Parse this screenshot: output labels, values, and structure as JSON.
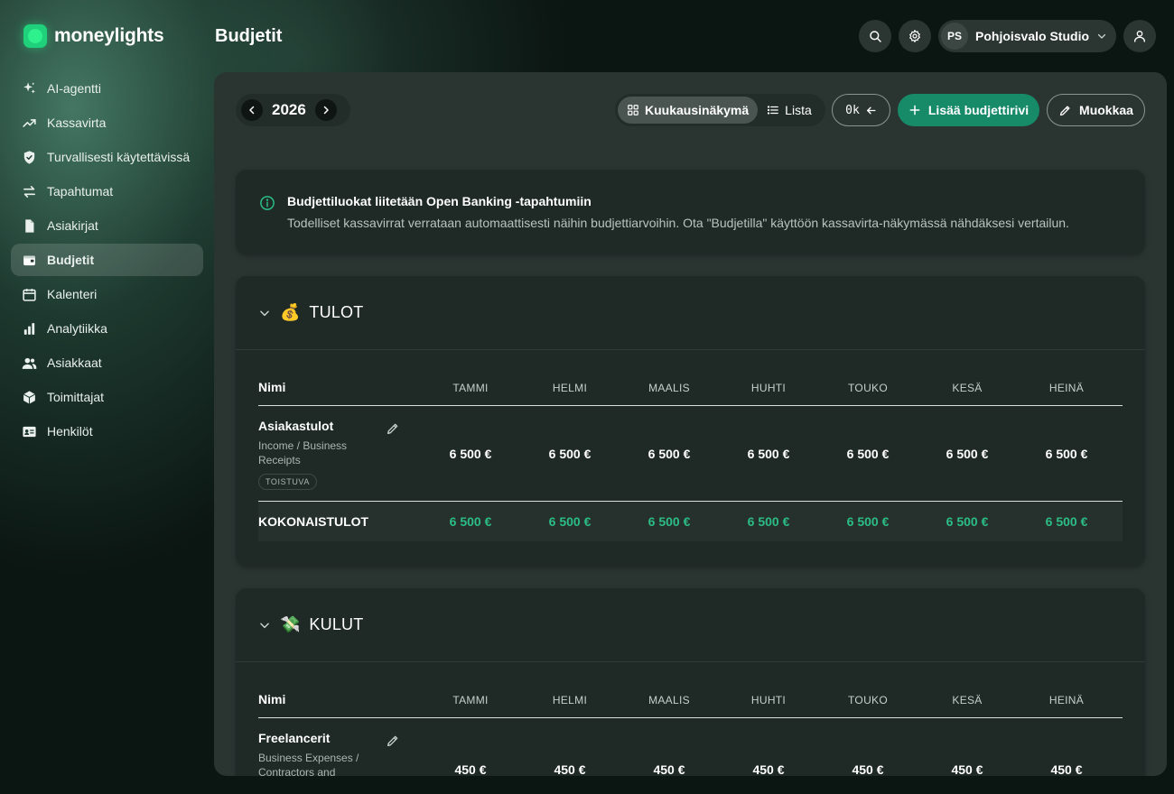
{
  "app": {
    "name": "moneylights"
  },
  "sidebar": {
    "items": [
      {
        "label": "AI-agentti",
        "icon": "sparkles-icon"
      },
      {
        "label": "Kassavirta",
        "icon": "trend-up-icon"
      },
      {
        "label": "Turvallisesti käytettävissä",
        "icon": "shield-check-icon"
      },
      {
        "label": "Tapahtumat",
        "icon": "swap-arrows-icon"
      },
      {
        "label": "Asiakirjat",
        "icon": "document-icon"
      },
      {
        "label": "Budjetit",
        "icon": "wallet-icon",
        "active": true
      },
      {
        "label": "Kalenteri",
        "icon": "calendar-icon"
      },
      {
        "label": "Analytiikka",
        "icon": "bar-chart-icon"
      },
      {
        "label": "Asiakkaat",
        "icon": "users-icon"
      },
      {
        "label": "Toimittajat",
        "icon": "box-icon"
      },
      {
        "label": "Henkilöt",
        "icon": "id-card-icon"
      }
    ]
  },
  "header": {
    "title": "Budjetit",
    "org": {
      "initials": "PS",
      "name": "Pohjoisvalo Studio"
    }
  },
  "toolbar": {
    "year": "2026",
    "view_monthly": "Kuukausinäkymä",
    "view_list": "Lista",
    "zero_label": "0k",
    "add_label": "Lisää budjettirivi",
    "edit_label": "Muokkaa"
  },
  "info": {
    "title": "Budjettiluokat liitetään Open Banking -tapahtumiin",
    "description": "Todelliset kassavirrat verrataan automaattisesti näihin budjettiarvoihin. Ota \"Budjetilla\" käyttöön kassavirta-näkymässä nähdäksesi vertailun."
  },
  "months": [
    "TAMMI",
    "HELMI",
    "MAALIS",
    "HUHTI",
    "TOUKO",
    "KESÄ",
    "HEINÄ"
  ],
  "income": {
    "emoji": "💰",
    "title": "TULOT",
    "name_header": "Nimi",
    "rows": [
      {
        "name": "Asiakastulot",
        "category": "Income / Business Receipts",
        "badge": "TOISTUVA",
        "values": [
          "6 500 €",
          "6 500 €",
          "6 500 €",
          "6 500 €",
          "6 500 €",
          "6 500 €",
          "6 500 €"
        ]
      }
    ],
    "total_label": "KOKONAISTULOT",
    "totals": [
      "6 500 €",
      "6 500 €",
      "6 500 €",
      "6 500 €",
      "6 500 €",
      "6 500 €",
      "6 500 €"
    ]
  },
  "expenses": {
    "emoji": "💸",
    "title": "KULUT",
    "name_header": "Nimi",
    "rows": [
      {
        "name": "Freelancerit",
        "category": "Business Expenses / Contractors and",
        "values": [
          "450 €",
          "450 €",
          "450 €",
          "450 €",
          "450 €",
          "450 €",
          "450 €"
        ]
      }
    ]
  }
}
